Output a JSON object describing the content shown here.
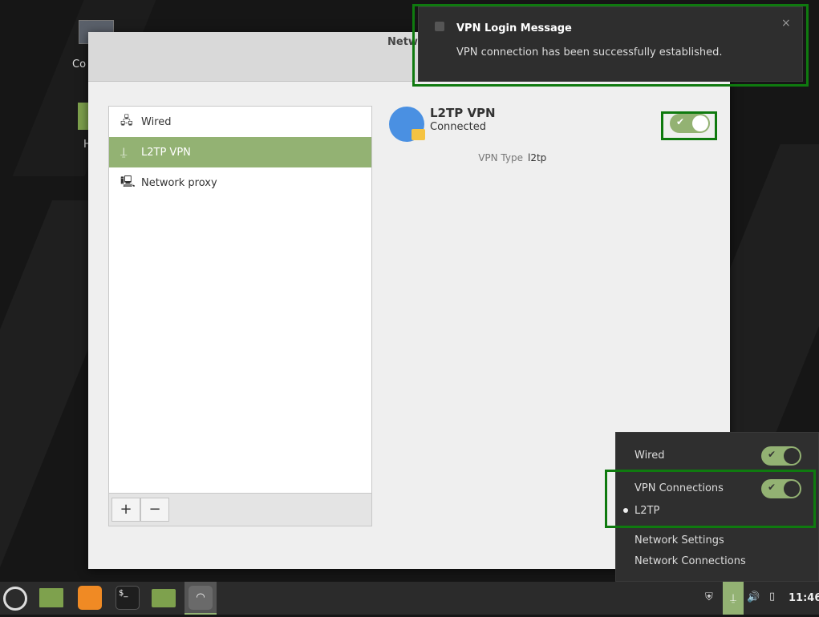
{
  "desktop": {
    "icons": [
      {
        "label": "Co"
      },
      {
        "label": "H"
      }
    ]
  },
  "window": {
    "title": "Netw",
    "sidebar": {
      "items": [
        {
          "label": "Wired",
          "icon": "wired-network-icon"
        },
        {
          "label": "L2TP VPN",
          "icon": "vpn-lock-icon",
          "selected": true
        },
        {
          "label": "Network proxy",
          "icon": "network-proxy-icon"
        }
      ],
      "add_label": "+",
      "remove_label": "−"
    },
    "detail": {
      "name": "L2TP VPN",
      "status": "Connected",
      "toggle_on": true,
      "vpn_type_label": "VPN Type",
      "vpn_type_value": "l2tp"
    }
  },
  "notification": {
    "title": "VPN Login Message",
    "body": "VPN connection has been successfully established.",
    "close": "×"
  },
  "network_menu": {
    "wired_label": "Wired",
    "wired_on": true,
    "vpn_label": "VPN Connections",
    "vpn_on": true,
    "vpn_item": "L2TP",
    "settings": "Network Settings",
    "connections": "Network Connections"
  },
  "taskbar": {
    "clock": "11:46",
    "terminal_glyph": "$_"
  },
  "colors": {
    "accent": "#93b273",
    "highlight": "#0f7a0f"
  }
}
